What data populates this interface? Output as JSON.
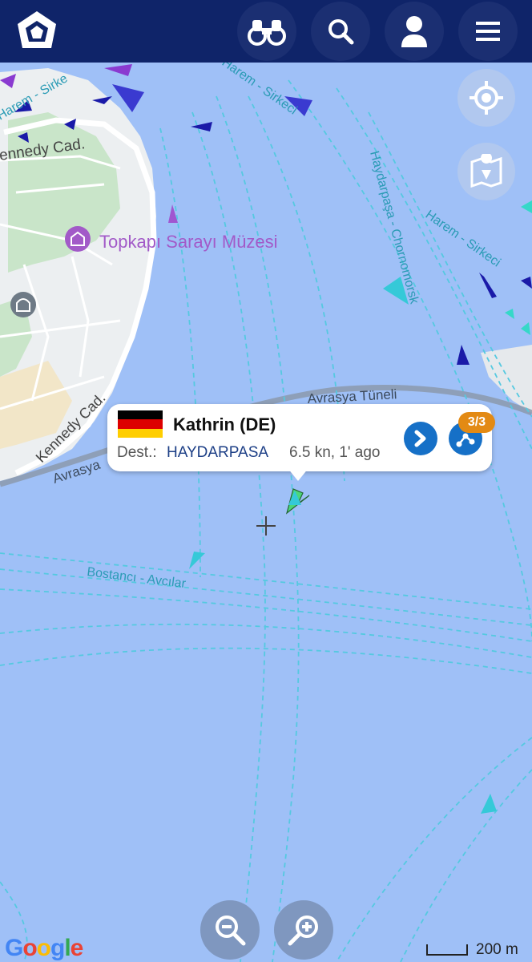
{
  "app": {
    "top_buttons": [
      "logo-icon",
      "binoculars-icon",
      "search-icon",
      "user-icon",
      "menu-icon"
    ]
  },
  "map": {
    "labels": {
      "kennedy_top": "ennedy Cad.",
      "kennedy_side": "Kennedy Cad.",
      "topkapi": "Topkapı Sarayı Müzesi",
      "harem_top": "Harem - Sirkeci",
      "harem_right": "Harem - Sirkeci",
      "sirkeci_left": "Harem - Sirke",
      "haydarpasa": "Haydarpaşa - Chornomorsk",
      "avrasya_tuneli": "Avrasya Tüneli",
      "avrasya": "Avrasya",
      "bostanci": "Bostancı - Avcılar"
    },
    "colors": {
      "water": "#9fc0f7",
      "land": "#eef0f1",
      "park": "#c8e6c8",
      "routes": "#55c9e0"
    }
  },
  "popup": {
    "flag": "germany-flag",
    "vessel_name": "Kathrin (DE)",
    "dest_label": "Dest.:",
    "destination": "HAYDARPASA",
    "speed_time": "6.5 kn, 1' ago",
    "badge": "3/3"
  },
  "controls": {
    "scale_label": "200 m",
    "attribution": "Google"
  }
}
